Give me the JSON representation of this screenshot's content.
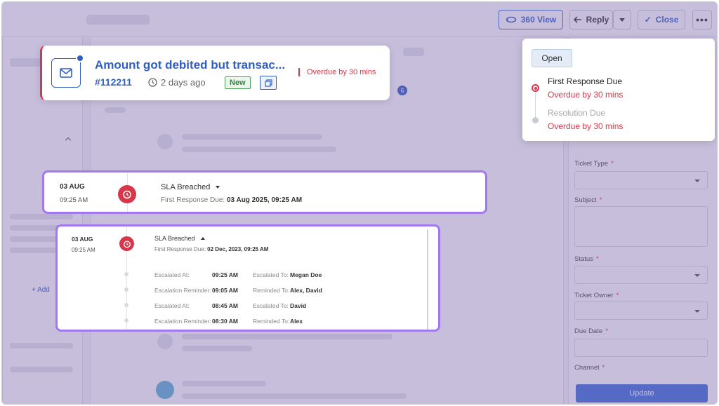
{
  "header": {
    "view_label": "360 View",
    "reply_label": "Reply",
    "close_label": "Close"
  },
  "ticket": {
    "title": "Amount got debited but transac...",
    "id": "#112211",
    "age": "2 days ago",
    "status_badge": "New",
    "overdue": "Overdue by 30 mins"
  },
  "tab_badge_count": "6",
  "sla_popup": {
    "status": "Open",
    "steps": [
      {
        "title": "First Response Due",
        "detail": "Overdue by 30 mins"
      },
      {
        "title": "Resolution Due",
        "detail": "Overdue by 30 mins"
      }
    ]
  },
  "sla_card_1": {
    "date": "03 AUG",
    "time": "09:25 AM",
    "title": "SLA Breached",
    "sub_label": "First Response Due:",
    "sub_value": "03 Aug 2025, 09:25 AM"
  },
  "sla_card_2": {
    "date": "03 AUG",
    "time": "09:25 AM",
    "title": "SLA Breached",
    "sub_label": "First Response Due:",
    "sub_value": "02 Dec, 2023, 09:25 AM",
    "escalations": [
      {
        "label": "Escalated At:",
        "time": "09:25 AM",
        "to_label": "Escalated To:",
        "to": "Megan Doe"
      },
      {
        "label": "Escalation Reminder:",
        "time": "09:05 AM",
        "to_label": "Reminded To:",
        "to": "Alex, David"
      },
      {
        "label": "Escalated At:",
        "time": "08:45 AM",
        "to_label": "Escalated To:",
        "to": "David"
      },
      {
        "label": "Escalation Reminder:",
        "time": "08:30 AM",
        "to_label": "Reminded To:",
        "to": "Alex"
      }
    ]
  },
  "right_panel": {
    "fields": [
      "Ticket Type",
      "Subject",
      "Status",
      "Ticket Owner",
      "Due Date",
      "Channel"
    ],
    "update_label": "Update"
  },
  "left_panel": {
    "add_label": "+ Add"
  },
  "colors": {
    "brand": "#2f5fc4",
    "danger": "#d9364a",
    "highlight_border": "#a178ee",
    "overlay": "#7864aa"
  }
}
